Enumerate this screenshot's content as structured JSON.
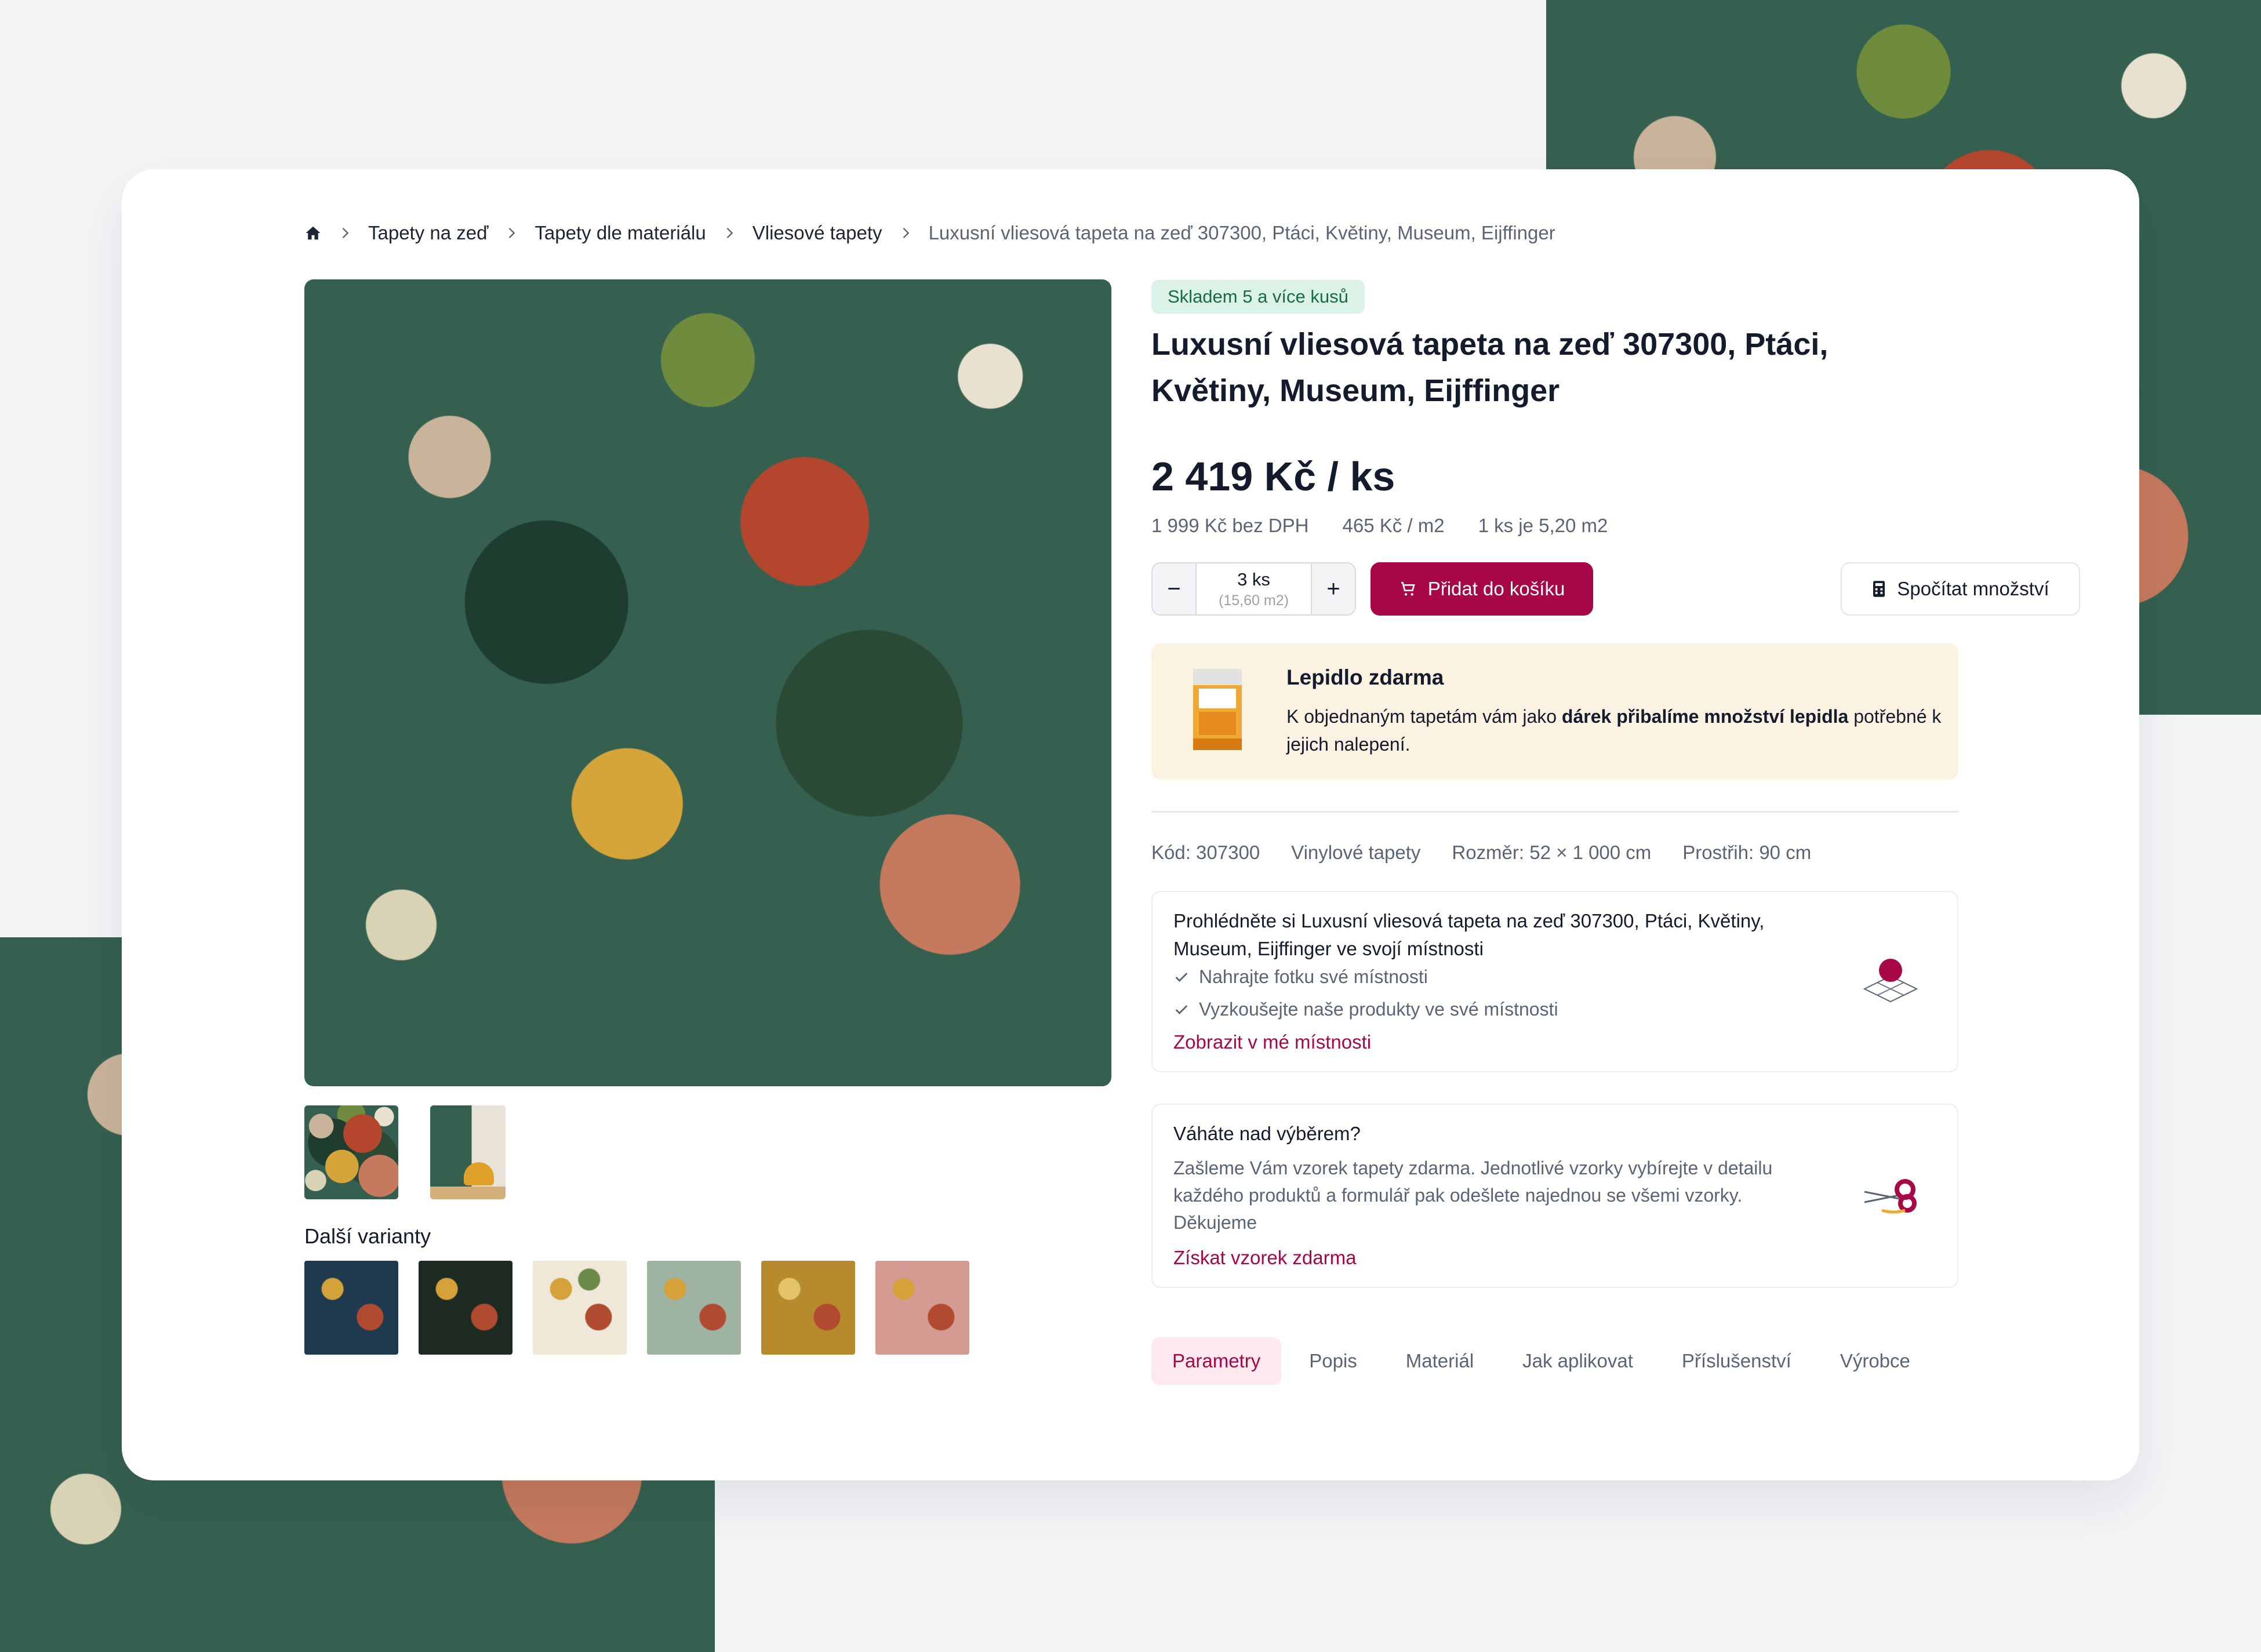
{
  "colors": {
    "brand": "#a80747",
    "stock_bg": "#daf3e6",
    "stock_text": "#1a6b43",
    "promo_bg": "#fcf2e2"
  },
  "breadcrumb": {
    "home_icon": "home-icon",
    "items": [
      "Tapety na zeď",
      "Tapety dle materiálu",
      "Vliesové tapety"
    ],
    "current": "Luxusní vliesová tapeta na zeď 307300, Ptáci, Květiny, Museum, Eijffinger"
  },
  "gallery": {
    "variants_title": "Další varianty"
  },
  "product": {
    "stock": "Skladem 5 a více kusů",
    "title": "Luxusní vliesová tapeta na zeď 307300, Ptáci, Květiny, Museum, Eijffinger",
    "price": "2 419 Kč / ks",
    "price_ex_vat": "1 999 Kč bez DPH",
    "price_per_m2": "465 Kč / m2",
    "area_per_piece": "1 ks je 5,20 m2"
  },
  "cart": {
    "minus": "−",
    "plus": "+",
    "quantity": "3 ks",
    "quantity_area": "(15,60 m2)",
    "add_label": "Přidat do košíku",
    "calc_label": "Spočítat množství"
  },
  "promo": {
    "title": "Lepidlo zdarma",
    "text_before": "K objednaným tapetám vám jako ",
    "text_bold": "dárek přibalíme množství lepidla",
    "text_after": " potřebné k jejich nalepení."
  },
  "meta": {
    "code": "Kód: 307300",
    "type": "Vinylové tapety",
    "size": "Rozměr: 52 × 1 000 cm",
    "repeat": "Prostřih: 90 cm"
  },
  "room_card": {
    "title": "Prohlédněte si Luxusní vliesová tapeta na zeď 307300, Ptáci, Květiny, Museum, Eijffinger ve svojí místnosti",
    "checks": [
      "Nahrajte fotku své místnosti",
      "Vyzkoušejte naše produkty ve své místnosti"
    ],
    "link": "Zobrazit v mé místnosti"
  },
  "sample_card": {
    "title": "Váháte nad výběrem?",
    "text": "Zašleme Vám vzorek tapety zdarma. Jednotlivé vzorky vybírejte v detailu každého produktů a formulář pak odešlete najednou se všemi vzorky. Děkujeme",
    "link": "Získat vzorek zdarma"
  },
  "tabs": [
    "Parametry",
    "Popis",
    "Materiál",
    "Jak aplikovat",
    "Příslušenství",
    "Výrobce"
  ],
  "active_tab": "Parametry"
}
